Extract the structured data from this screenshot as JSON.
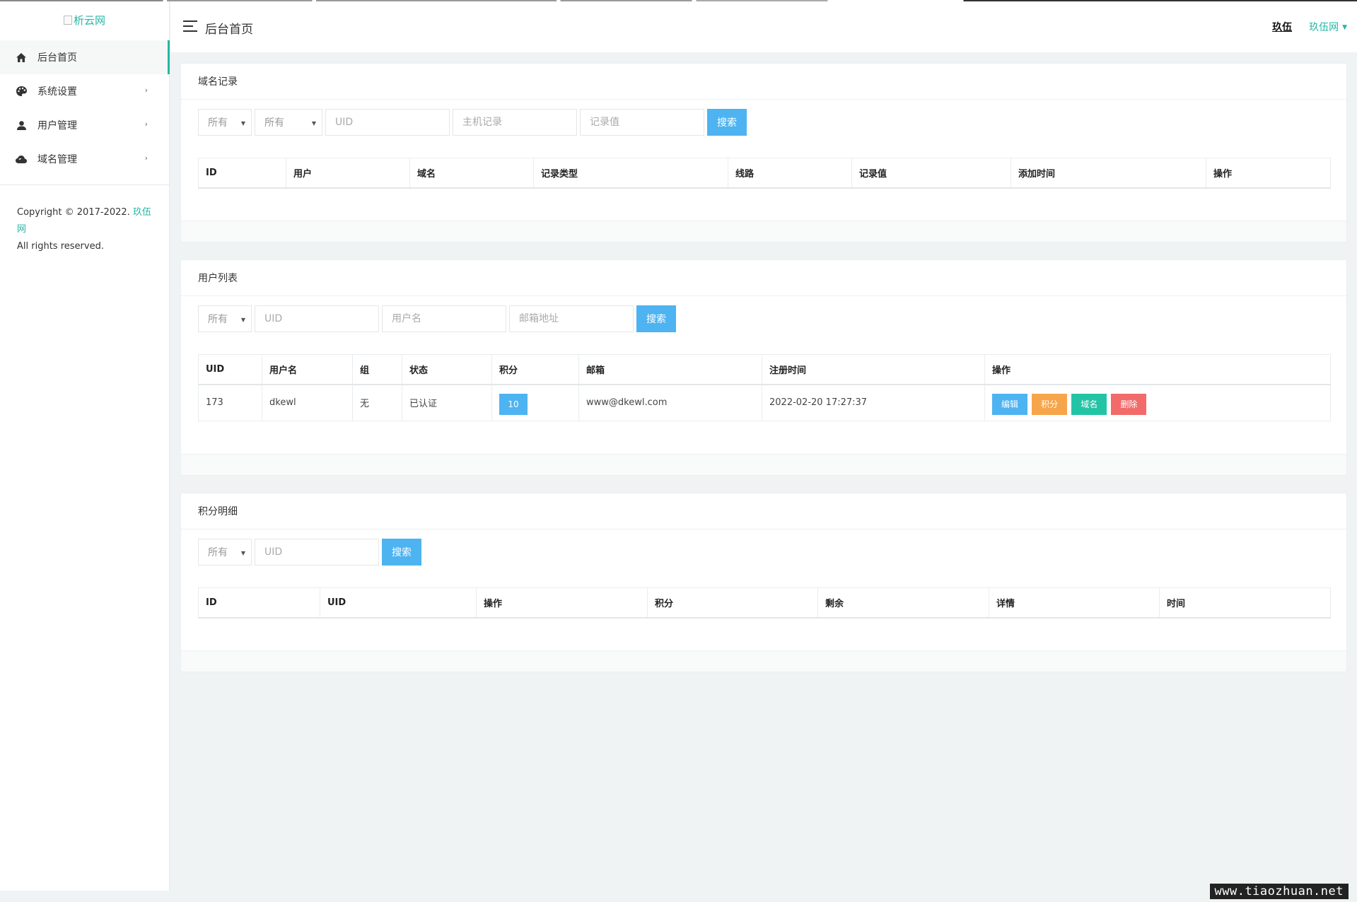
{
  "logo": {
    "alt_text": "析云网"
  },
  "sidebar": {
    "items": [
      {
        "label": "后台首页",
        "icon": "home-icon",
        "active": true,
        "has_arrow": false
      },
      {
        "label": "系统设置",
        "icon": "palette-icon",
        "active": false,
        "has_arrow": true
      },
      {
        "label": "用户管理",
        "icon": "user-icon",
        "active": false,
        "has_arrow": true
      },
      {
        "label": "域名管理",
        "icon": "cloud-icon",
        "active": false,
        "has_arrow": true
      }
    ],
    "arrow_glyph": "›",
    "copyright_prefix": "Copyright © 2017-2022.",
    "copyright_brand": "玖伍网",
    "copyright_rights": "All rights reserved."
  },
  "header": {
    "title": "后台首页",
    "user": "玖伍",
    "site": "玖伍网"
  },
  "domain_records": {
    "title": "域名记录",
    "select1": "所有",
    "select2": "所有",
    "uid_placeholder": "UID",
    "host_placeholder": "主机记录",
    "value_placeholder": "记录值",
    "search_label": "搜索",
    "columns": [
      "ID",
      "用户",
      "域名",
      "记录类型",
      "线路",
      "记录值",
      "添加时间",
      "操作"
    ]
  },
  "user_list": {
    "title": "用户列表",
    "select1": "所有",
    "uid_placeholder": "UID",
    "username_placeholder": "用户名",
    "email_placeholder": "邮箱地址",
    "search_label": "搜索",
    "columns": [
      "UID",
      "用户名",
      "组",
      "状态",
      "积分",
      "邮箱",
      "注册时间",
      "操作"
    ],
    "rows": [
      {
        "uid": "173",
        "username": "dkewl",
        "group": "无",
        "status": "已认证",
        "points": "10",
        "email": "www@dkewl.com",
        "registered": "2022-02-20 17:27:37",
        "actions": [
          "编辑",
          "积分",
          "域名",
          "删除"
        ]
      }
    ]
  },
  "points_detail": {
    "title": "积分明细",
    "select1": "所有",
    "uid_placeholder": "UID",
    "search_label": "搜索",
    "columns": [
      "ID",
      "UID",
      "操作",
      "积分",
      "剩余",
      "详情",
      "时间"
    ]
  },
  "watermark": "www.tiaozhuan.net",
  "colors": {
    "accent": "#23b7a5",
    "primary": "#4eb3f1",
    "warning": "#f7a54a",
    "success": "#23c4a6",
    "danger": "#f26a6a"
  }
}
